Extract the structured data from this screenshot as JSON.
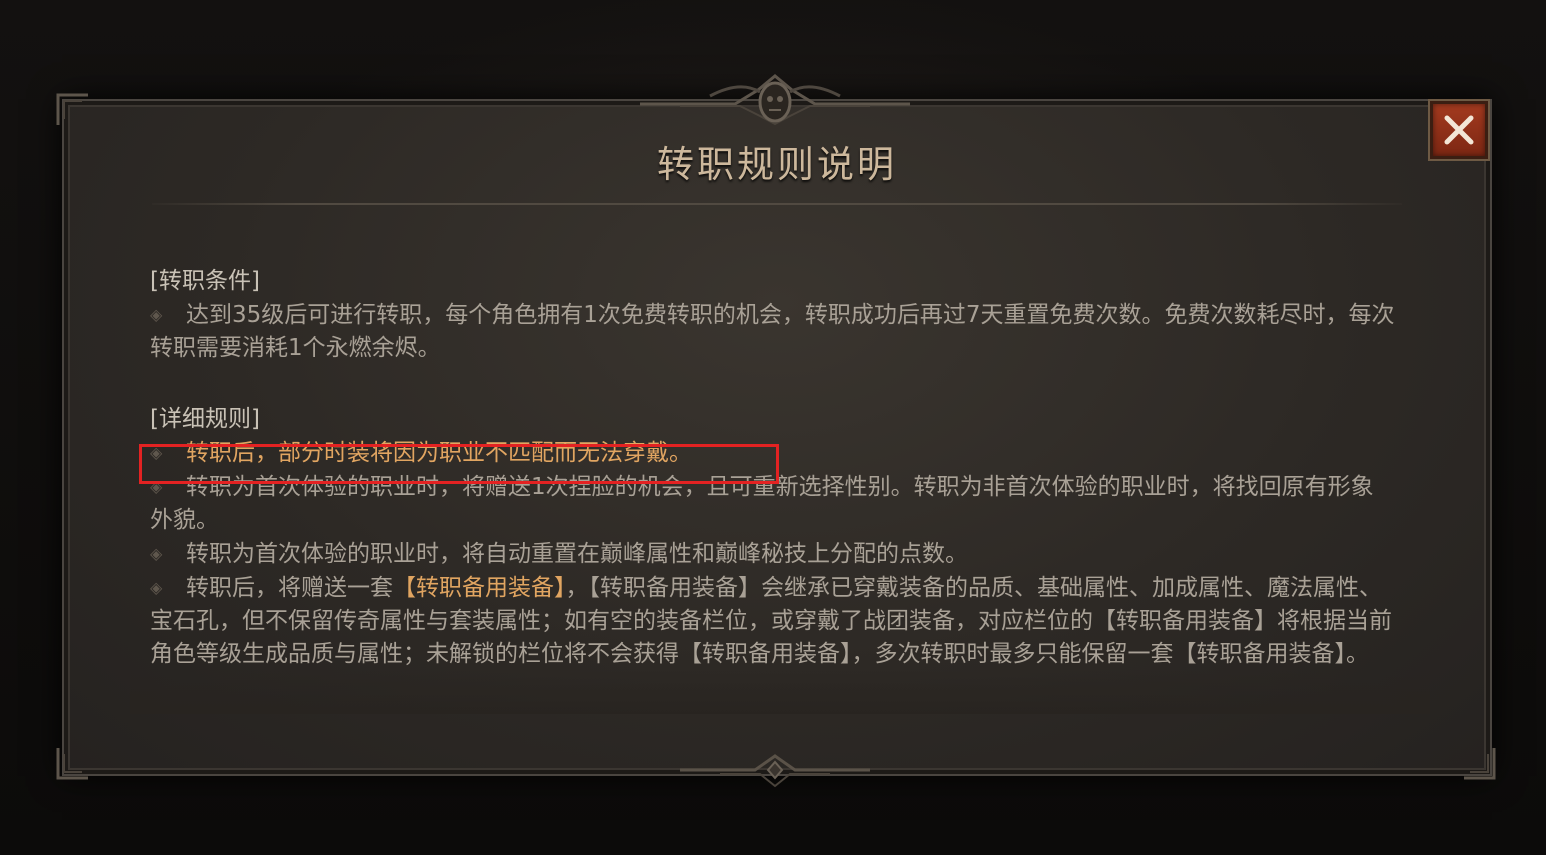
{
  "dialog": {
    "title": "转职规则说明",
    "close_icon": "close-x-icon",
    "colors": {
      "accent_text": "#e1a561",
      "close_button": "#a33a1f",
      "highlight_border": "#e32222"
    }
  },
  "sections": [
    {
      "heading": "[转职条件]",
      "paragraphs": [
        {
          "text": "达到35级后可进行转职，每个角色拥有1次免费转职的机会，转职成功后再过7天重置免费次数。免费次数耗尽时，每次转职需要消耗1个永燃余烬。"
        }
      ]
    },
    {
      "heading": "[详细规则]",
      "paragraphs": [
        {
          "text": "转职后，部分时装将因为职业不匹配而无法穿戴。"
        },
        {
          "text": "转职为首次体验的职业时，将赠送1次捏脸的机会，且可重新选择性别。转职为非首次体验的职业时，将找回原有形象外貌。"
        },
        {
          "text": "转职为首次体验的职业时，将自动重置在巅峰属性和巅峰秘技上分配的点数。"
        },
        {
          "parts": [
            "转职后，将赠送一套",
            "【转职备用装备】",
            "，【转职备用装备】会继承已穿戴装备的品质、基础属性、加成属性、魔法属性、宝石孔，但不保留传奇属性与套装属性；如有空的装备栏位，或穿戴了战团装备，对应栏位的【转职备用装备】将根据当前角色等级生成品质与属性；未解锁的栏位将不会获得【转职备用装备】，多次转职时最多只能保留一套【转职备用装备】。"
          ]
        }
      ]
    }
  ],
  "bullet_icon": "diamond-bullet-icon"
}
